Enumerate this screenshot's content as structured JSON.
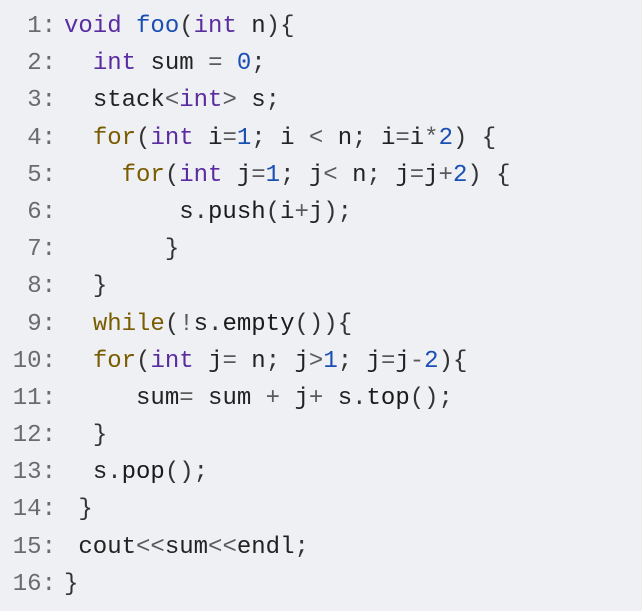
{
  "lines": {
    "l1": {
      "num": "1:",
      "void": "void",
      "foo": "foo",
      "int": "int",
      "param": "n"
    },
    "l2": {
      "num": "2:",
      "int": "int",
      "ident": "sum",
      "eq": "=",
      "val": "0"
    },
    "l3": {
      "num": "3:",
      "stack": "stack",
      "lt": "<",
      "int": "int",
      "gt": ">",
      "ident": "s"
    },
    "l4": {
      "num": "4:",
      "for": "for",
      "int": "int",
      "i": "i",
      "one": "1",
      "lt": "<",
      "n": "n",
      "star": "*",
      "two": "2"
    },
    "l5": {
      "num": "5:",
      "for": "for",
      "int": "int",
      "j": "j",
      "one": "1",
      "lt": "<",
      "n": "n",
      "plus": "+",
      "two": "2"
    },
    "l6": {
      "num": "6:",
      "s": "s",
      "push": "push",
      "i": "i",
      "plus": "+",
      "j": "j"
    },
    "l7": {
      "num": "7:"
    },
    "l8": {
      "num": "8:"
    },
    "l9": {
      "num": "9:",
      "while": "while",
      "bang": "!",
      "s": "s",
      "empty": "empty"
    },
    "l10": {
      "num": "10:",
      "for": "for",
      "int": "int",
      "j": "j",
      "n": "n",
      "gt": ">",
      "one": "1",
      "minus": "-",
      "two": "2"
    },
    "l11": {
      "num": "11:",
      "sum": "sum",
      "plus": "+",
      "j": "j",
      "s": "s",
      "top": "top"
    },
    "l12": {
      "num": "12:"
    },
    "l13": {
      "num": "13:",
      "s": "s",
      "pop": "pop"
    },
    "l14": {
      "num": "14:"
    },
    "l15": {
      "num": "15:",
      "cout": "cout",
      "lt": "<<",
      "sum": "sum",
      "endl": "endl"
    },
    "l16": {
      "num": "16:"
    }
  }
}
